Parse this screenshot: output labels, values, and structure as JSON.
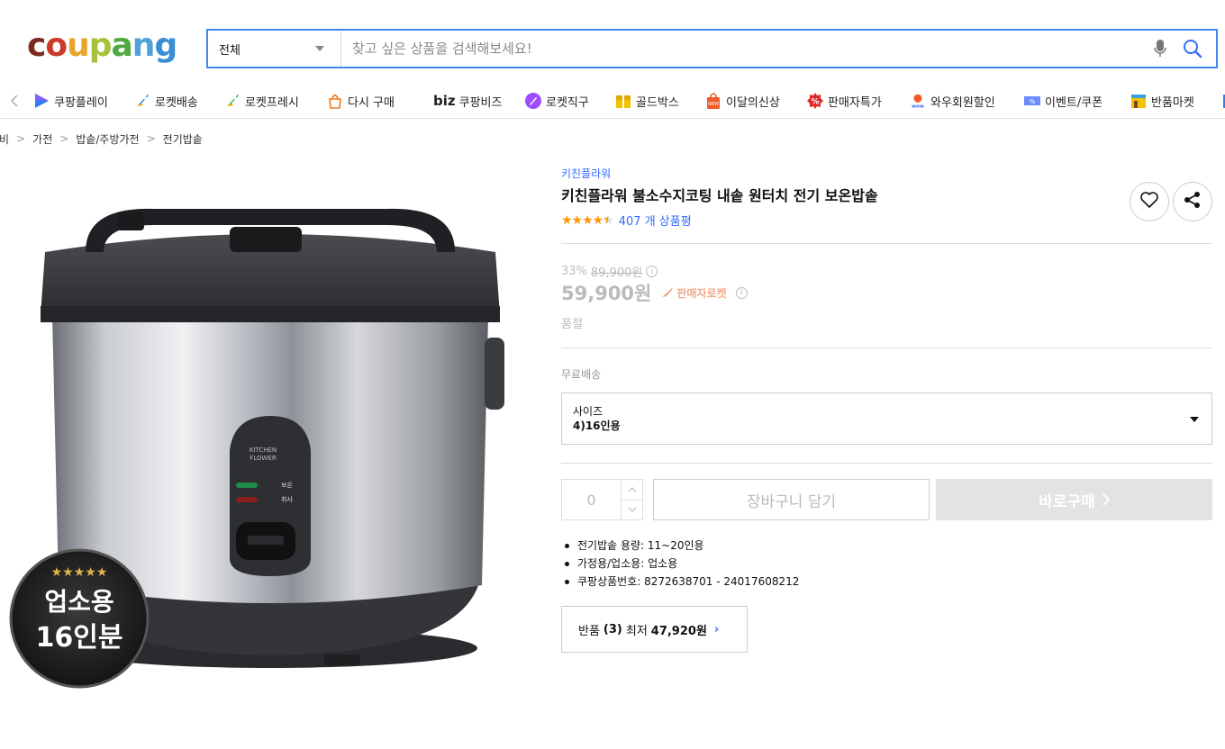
{
  "header": {
    "logo_text": "coupang",
    "search": {
      "category": "전체",
      "placeholder": "찾고 싶은 상품을 검색해보세요!",
      "icons": [
        "chevron-down-icon",
        "microphone-icon",
        "search-icon"
      ]
    }
  },
  "nav": {
    "items": [
      {
        "label": "쿠팡플레이",
        "icon": "play-icon"
      },
      {
        "label": "로켓배송",
        "icon": "rocket-icon"
      },
      {
        "label": "로켓프레시",
        "icon": "rocket-fresh-icon"
      },
      {
        "label": "다시 구매",
        "icon": "rebuy-bag-icon"
      },
      {
        "label": "쿠팡비즈",
        "prefix": "biz",
        "icon": "biz-icon"
      },
      {
        "label": "로켓직구",
        "icon": "rocket-global-icon"
      },
      {
        "label": "골드박스",
        "icon": "goldbox-icon"
      },
      {
        "label": "이달의신상",
        "icon": "new-bag-icon"
      },
      {
        "label": "판매자특가",
        "icon": "percent-badge-icon"
      },
      {
        "label": "와우회원할인",
        "icon": "wow-icon"
      },
      {
        "label": "이벤트/쿠폰",
        "icon": "coupon-icon"
      },
      {
        "label": "반품마켓",
        "icon": "return-market-icon"
      }
    ]
  },
  "breadcrumb": [
    "준비",
    "가전",
    "밥솥/주방가전",
    "전기밥솥"
  ],
  "product": {
    "badge_line1": "업소용",
    "badge_line2": "16인분",
    "device_brand_line1": "KITCHEN",
    "device_brand_line2": "FLOWER",
    "device_label_warm": "보온",
    "device_label_cook": "취사",
    "brand": "키친플라워",
    "title": "키친플라워 불소수지코팅 내솥 원터치 전기 보온밥솥",
    "rating": 4.5,
    "review_count": "407 개 상품평",
    "discount_rate": "33%",
    "original_price": "89,900원",
    "price": "59,900원",
    "rocket_badge": "판매자로켓",
    "soldout": "품절",
    "shipping": "무료배송",
    "option": {
      "label": "사이즈",
      "value": "4)16인용"
    },
    "quantity": "0",
    "cart_button": "장바구니 담기",
    "buy_button": "바로구매",
    "attributes": [
      "전기밥솥 용량: 11~20인용",
      "가정용/업소용: 업소용",
      "쿠팡상품번호: 8272638701 - 24017608212"
    ],
    "return_offer": {
      "prefix": "반품",
      "count": "(3)",
      "label": "최저",
      "price": "47,920원"
    }
  },
  "colors": {
    "accent_blue": "#346aff",
    "search_border": "#4285f4",
    "star": "#ff9600",
    "rocket": "#f2aa8e",
    "disabled_button": "#e3e3e3"
  }
}
